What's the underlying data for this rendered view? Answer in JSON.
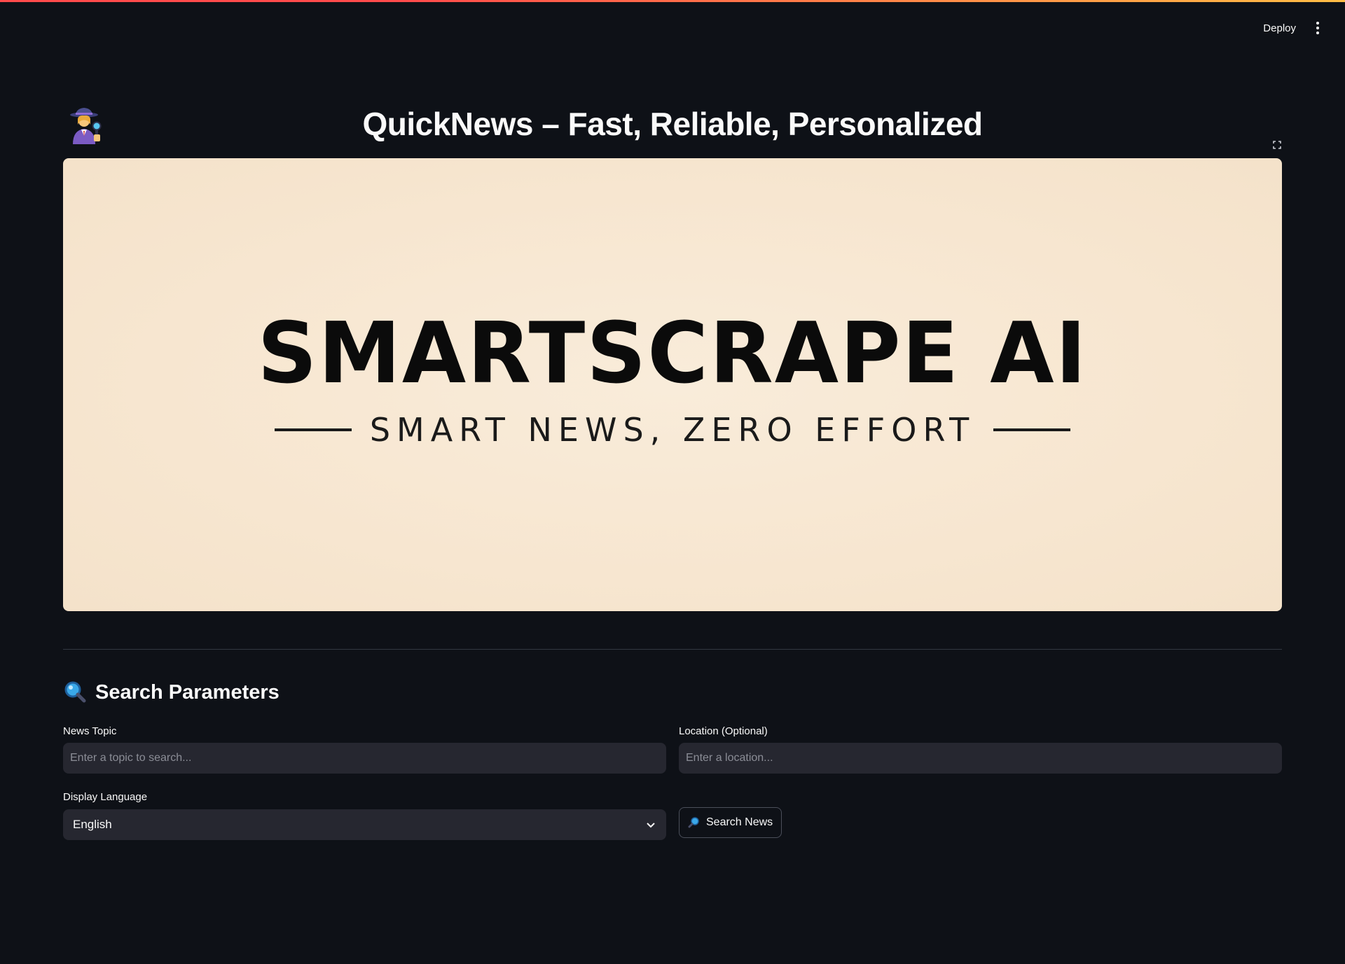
{
  "header": {
    "deploy_label": "Deploy",
    "menu_icon": "kebab-menu-icon"
  },
  "page": {
    "title_icon": "detective-icon",
    "title": "QuickNews – Fast, Reliable, Personalized",
    "fullscreen_icon": "fullscreen-icon"
  },
  "banner": {
    "logo_text": "SMARTSCRAPE AI",
    "tagline": "SMART NEWS, ZERO EFFORT"
  },
  "search": {
    "section_icon": "magnifier-icon",
    "section_title": "Search Parameters",
    "topic": {
      "label": "News Topic",
      "placeholder": "Enter a topic to search...",
      "value": ""
    },
    "location": {
      "label": "Location (Optional)",
      "placeholder": "Enter a location...",
      "value": ""
    },
    "language": {
      "label": "Display Language",
      "selected": "English"
    },
    "button_label": "Search News",
    "button_icon": "magnifier-icon"
  },
  "colors": {
    "background": "#0e1117",
    "input_background": "#262730",
    "accent": "#ff4b4b",
    "banner_background": "#f7e6d0"
  }
}
